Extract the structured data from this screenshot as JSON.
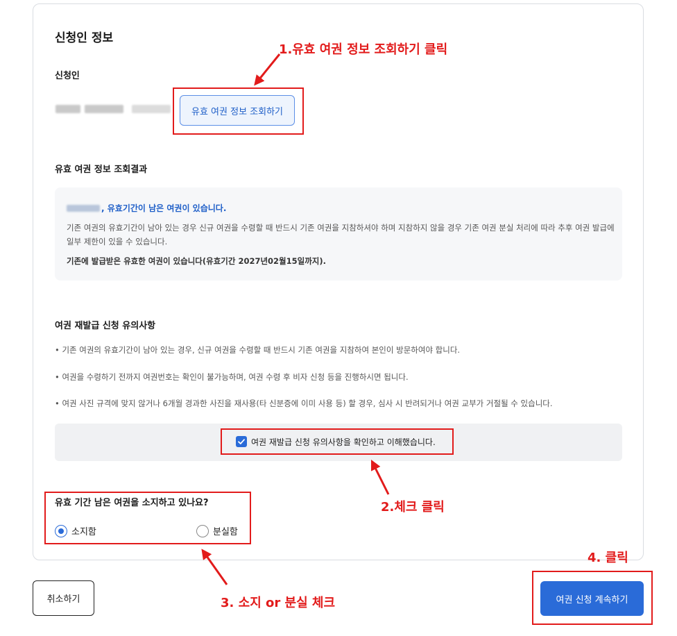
{
  "section_title": "신청인 정보",
  "applicant_label": "신청인",
  "lookup_button": "유효 여권 정보 조회하기",
  "result": {
    "title": "유효 여권 정보 조회결과",
    "headline": ", 유효기간이 남은 여권이 있습니다.",
    "description": "기존 여권의 유효기간이 남아 있는 경우 신규 여권을 수령할 때 반드시 기존 여권을 지참하셔야 하며 지참하지 않을 경우 기존 여권 분실 처리에 따라 추후 여권 발급에 일부 제한이 있을 수 있습니다.",
    "note": "기존에 발급받은 유효한 여권이 있습니다(유효기간 2027년02월15일까지)."
  },
  "notice": {
    "title": "여권 재발급 신청 유의사항",
    "items": [
      "• 기존 여권의 유효기간이 남아 있는 경우, 신규 여권을 수령할 때 반드시 기존 여권을 지참하여 본인이 방문하여야 합니다.",
      "• 여권을 수령하기 전까지 여권번호는 확인이 불가능하며, 여권 수령 후 비자 신청 등을 진행하시면 됩니다.",
      "• 여권 사진 규격에 맞지 않거나 6개월 경과한 사진을 재사용(타 신분증에 이미 사용 등) 할 경우, 심사 시 반려되거나 여권 교부가 거절될 수 있습니다."
    ]
  },
  "confirm": {
    "label": "여권 재발급 신청 유의사항을 확인하고 이해했습니다.",
    "checked": true
  },
  "question": {
    "title": "유효 기간 남은 여권을 소지하고 있나요?",
    "options": [
      "소지함",
      "분실함"
    ],
    "selected": "소지함"
  },
  "buttons": {
    "cancel": "취소하기",
    "continue": "여권 신청 계속하기"
  },
  "annotations": {
    "step1": "1.유효 여권 정보 조회하기 클릭",
    "step2": "2.체크 클릭",
    "step3": "3. 소지 or 분실 체크",
    "step4": "4. 클릭"
  },
  "colors": {
    "accent": "#2a6bd8",
    "annotation_red": "#e21b1b"
  }
}
